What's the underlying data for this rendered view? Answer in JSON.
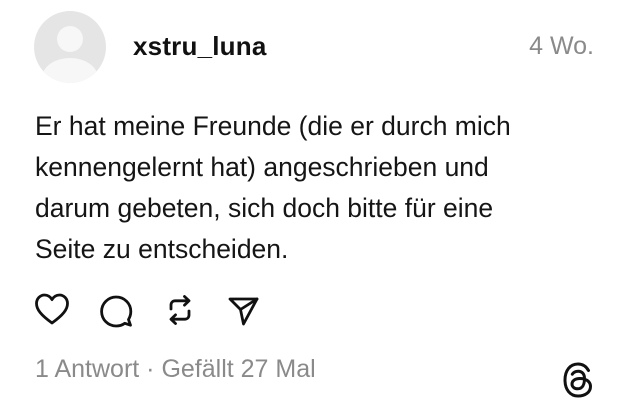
{
  "post": {
    "username": "xstru_luna",
    "time": "4 Wo.",
    "text": "Er hat meine Freunde (die er durch mich\nkennengelernt hat) angeschrieben und\ndarum gebeten, sich doch bitte für eine\nSeite zu entscheiden.",
    "stats": "1 Antwort · Gefällt 27 Mal"
  },
  "icons": {
    "like": "heart-icon",
    "comment": "comment-bubble-icon",
    "repost": "repost-arrows-icon",
    "share": "send-arrow-icon",
    "brand": "threads-logo-icon"
  },
  "colors": {
    "text": "#151515",
    "muted": "#8a8a8a",
    "avatar_bg": "#e5e5e5"
  }
}
